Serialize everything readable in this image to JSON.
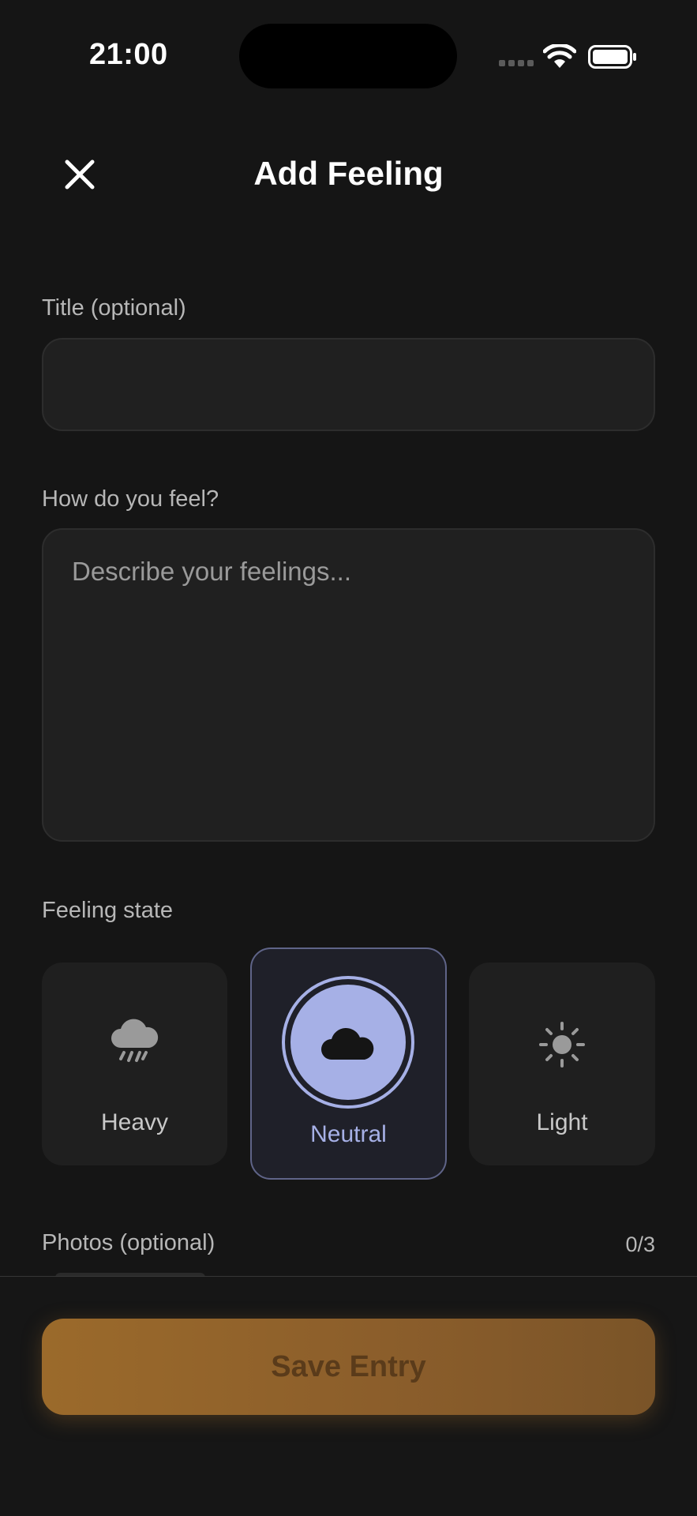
{
  "status_bar": {
    "time": "21:00"
  },
  "header": {
    "title": "Add Feeling"
  },
  "form": {
    "title_label": "Title (optional)",
    "title_value": "",
    "feel_label": "How do you feel?",
    "feel_placeholder": "Describe your feelings...",
    "state_label": "Feeling state",
    "states": [
      {
        "label": "Heavy",
        "icon": "rain-cloud-icon",
        "selected": false
      },
      {
        "label": "Neutral",
        "icon": "cloud-icon",
        "selected": true
      },
      {
        "label": "Light",
        "icon": "sun-icon",
        "selected": false
      }
    ],
    "photos_label": "Photos (optional)",
    "photos_count": "0/3"
  },
  "footer": {
    "save_label": "Save Entry"
  },
  "colors": {
    "background": "#151515",
    "accent_selected": "#a6b0e6",
    "save_button": "#9b6a2b"
  }
}
